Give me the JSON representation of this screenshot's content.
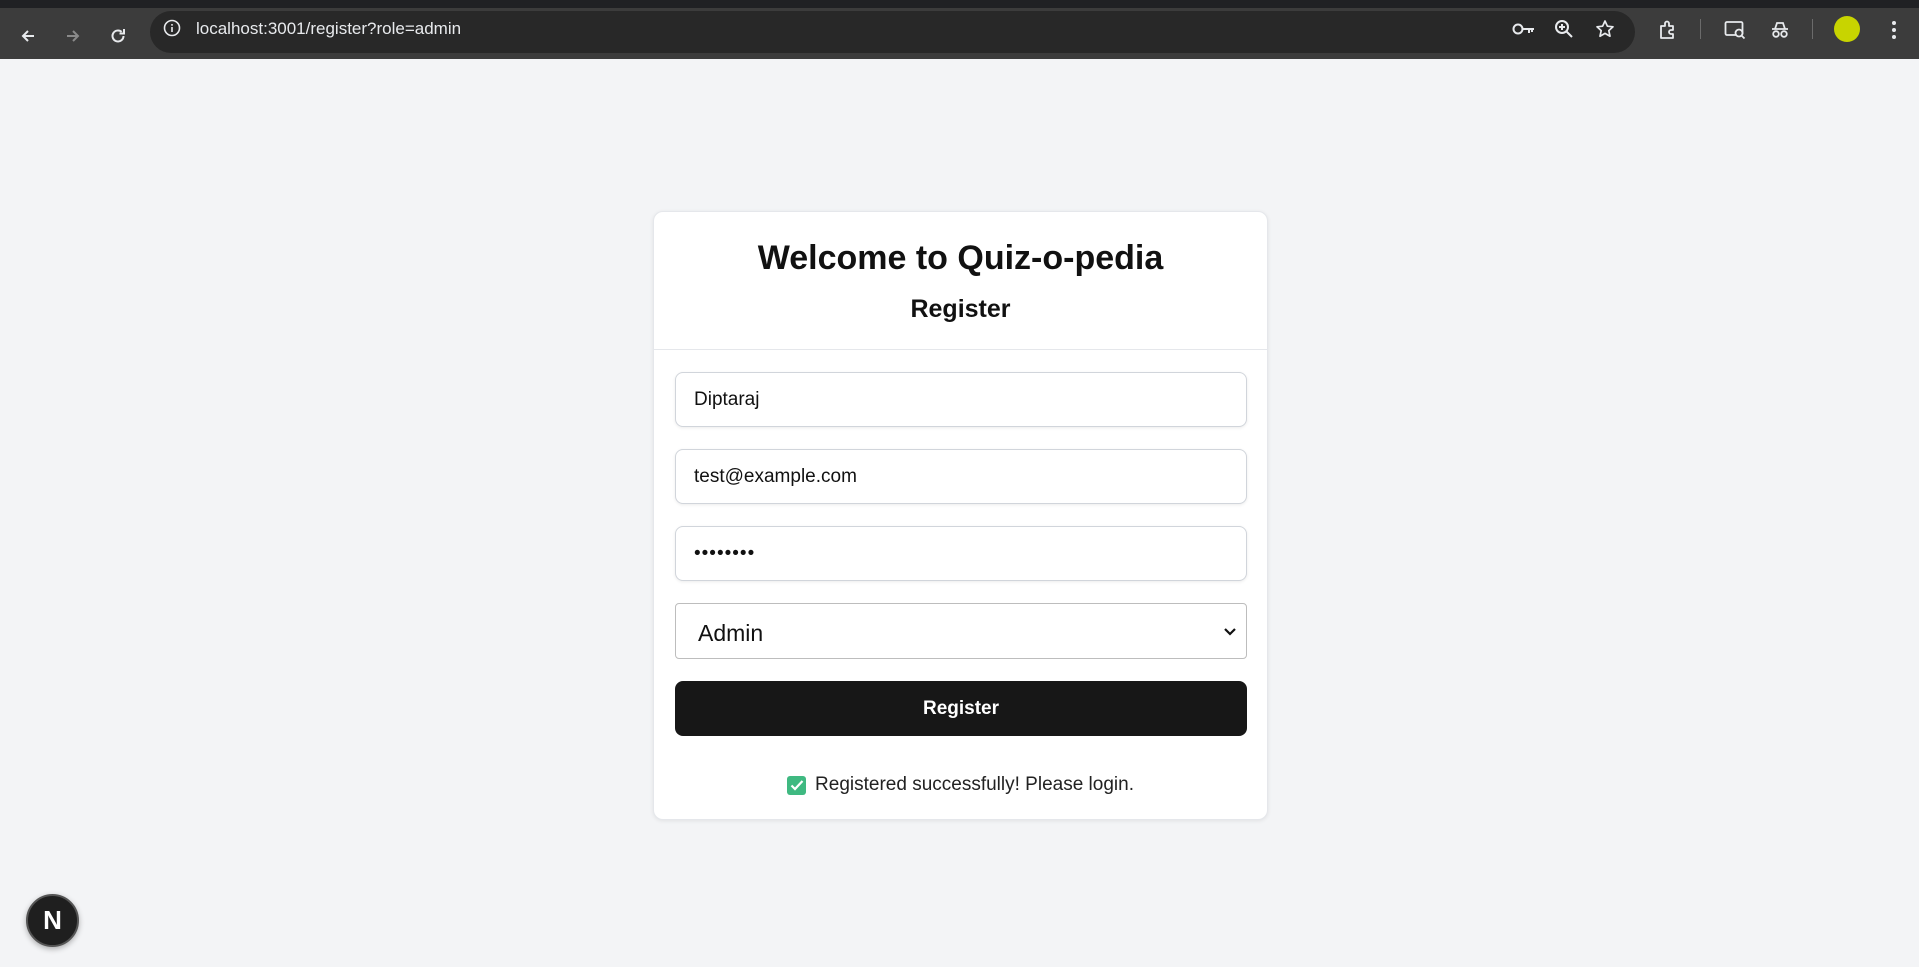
{
  "browser": {
    "url": "localhost:3001/register?role=admin"
  },
  "card": {
    "title": "Welcome to Quiz-o-pedia",
    "subtitle": "Register",
    "name_value": "Diptaraj",
    "email_value": "test@example.com",
    "password_value": "••••••••",
    "role_value": "Admin",
    "submit_label": "Register",
    "status_message": "Registered successfully! Please login."
  },
  "badge": {
    "letter": "N"
  },
  "colors": {
    "success": "#3fb981",
    "button": "#171717",
    "background": "#f3f4f6",
    "profile": "#c8d400"
  }
}
